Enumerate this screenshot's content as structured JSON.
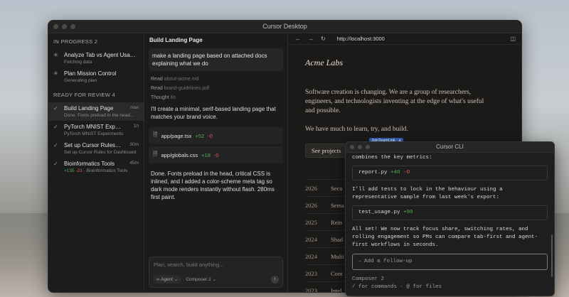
{
  "window": {
    "title": "Cursor Desktop"
  },
  "sidebar": {
    "in_progress_label": "IN PROGRESS 2",
    "in_progress": [
      {
        "title": "Analyze Tab vs Agent Usage P...",
        "subtitle": "Fetching data",
        "time": ""
      },
      {
        "title": "Plan Mission Control",
        "subtitle": "Generating plan",
        "time": ""
      }
    ],
    "ready_label": "READY FOR REVIEW 4",
    "ready": [
      {
        "title": "Build Landing Page",
        "subtitle": "Done. Fonts preload in the head...",
        "time": "now"
      },
      {
        "title": "PyTorch MNIST Experim...",
        "subtitle": "PyTorch MNIST Experiments",
        "time": "1h"
      },
      {
        "title": "Set up Cursor Rules for...",
        "subtitle": "Set up Cursor Rules for Dashboard",
        "time": "30m"
      },
      {
        "title": "Bioinformatics Tools",
        "add": "+135",
        "del": "-21",
        "subtitle": "· Bioinformatics Tools",
        "time": "45m"
      }
    ]
  },
  "chat": {
    "title": "Build Landing Page",
    "user_message": "make a landing page based on attached docs explaining what we do",
    "read1_verb": "Read",
    "read1_file": "about-acme.md",
    "read2_verb": "Read",
    "read2_file": "brand-guidelines.pdf",
    "thought_verb": "Thought",
    "thought_time": "6s",
    "response1": "I'll create a minimal, serif-based landing page that matches your brand voice.",
    "files": [
      {
        "name": "app/page.tsx",
        "add": "+52",
        "del": "-0"
      },
      {
        "name": "app/globals.css",
        "add": "+18",
        "del": "-0"
      }
    ],
    "response2": "Done. Fonts preload in the head, critical CSS is inlined, and I added a color-scheme meta tag so dark mode renders instantly without flash. 280ms first paint.",
    "composer_placeholder": "Plan, search, build anything...",
    "mode_label": "Agent",
    "model_label": "Composer 2"
  },
  "browser": {
    "url": "http://localhost:3000",
    "brand": "Acme Labs",
    "para1": "Software creation is changing. We are a group of researchers, engineers, and technologists inventing at the edge of what's useful and possible.",
    "para2": "We have much to learn, try, and build.",
    "button": "See projects",
    "tag": "JoinTeamLink · a",
    "years": [
      {
        "year": "2026",
        "text": "Secu"
      },
      {
        "year": "2026",
        "text": "Sema"
      },
      {
        "year": "2025",
        "text": "Rein"
      },
      {
        "year": "2024",
        "text": "Shad"
      },
      {
        "year": "2024",
        "text": "Multi"
      },
      {
        "year": "2023",
        "text": "Cont"
      },
      {
        "year": "2023",
        "text": "Intel"
      }
    ]
  },
  "cli": {
    "title": "Cursor CLI",
    "line1": "combines the key metrics:",
    "file1": {
      "name": "report.py",
      "add": "+40",
      "del": "-0"
    },
    "line2": "I'll add tests to lock in the behaviour using a representative sample from last week's export:",
    "file2": {
      "name": "test_usage.py",
      "add": "+90"
    },
    "line3": "All set! We now track focus share, switching rates, and rolling engagement so PMs can compare tab-first and agent-first workflows in seconds.",
    "input_placeholder": "→ Add a follow-up",
    "model": "Composer 2",
    "hint": "/ for commands · @ for files"
  }
}
